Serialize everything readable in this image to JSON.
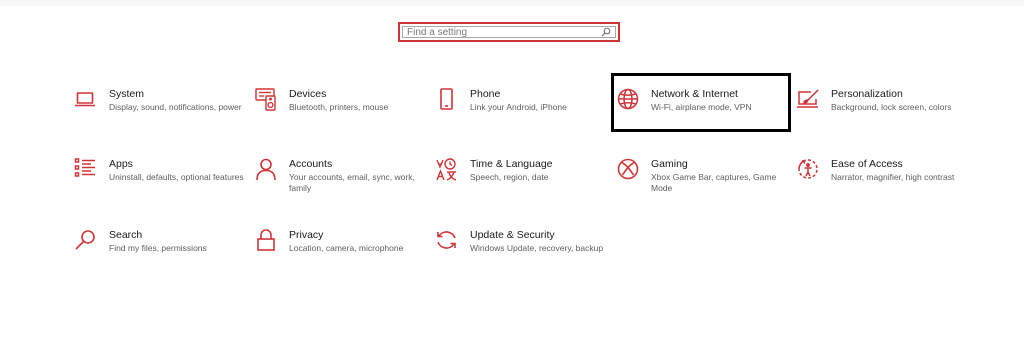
{
  "search": {
    "placeholder": "Find a setting",
    "value": ""
  },
  "accent_color": "#d13438",
  "tiles": [
    {
      "title": "System",
      "description": "Display, sound, notifications, power",
      "icon": "laptop-icon"
    },
    {
      "title": "Devices",
      "description": "Bluetooth, printers, mouse",
      "icon": "keyboard-speaker-icon"
    },
    {
      "title": "Phone",
      "description": "Link your Android, iPhone",
      "icon": "phone-icon"
    },
    {
      "title": "Network & Internet",
      "description": "Wi-Fi, airplane mode, VPN",
      "icon": "globe-icon"
    },
    {
      "title": "Personalization",
      "description": "Background, lock screen, colors",
      "icon": "paintbrush-screen-icon"
    },
    {
      "title": "Apps",
      "description": "Uninstall, defaults, optional features",
      "icon": "apps-list-icon"
    },
    {
      "title": "Accounts",
      "description": "Your accounts, email, sync, work, family",
      "icon": "person-icon"
    },
    {
      "title": "Time & Language",
      "description": "Speech, region, date",
      "icon": "time-language-icon"
    },
    {
      "title": "Gaming",
      "description": "Xbox Game Bar, captures, Game Mode",
      "icon": "xbox-icon"
    },
    {
      "title": "Ease of Access",
      "description": "Narrator, magnifier, high contrast",
      "icon": "ease-of-access-icon"
    },
    {
      "title": "Search",
      "description": "Find my files, permissions",
      "icon": "search-magnifier-icon"
    },
    {
      "title": "Privacy",
      "description": "Location, camera, microphone",
      "icon": "lock-icon"
    },
    {
      "title": "Update & Security",
      "description": "Windows Update, recovery, backup",
      "icon": "sync-arrows-icon"
    }
  ]
}
